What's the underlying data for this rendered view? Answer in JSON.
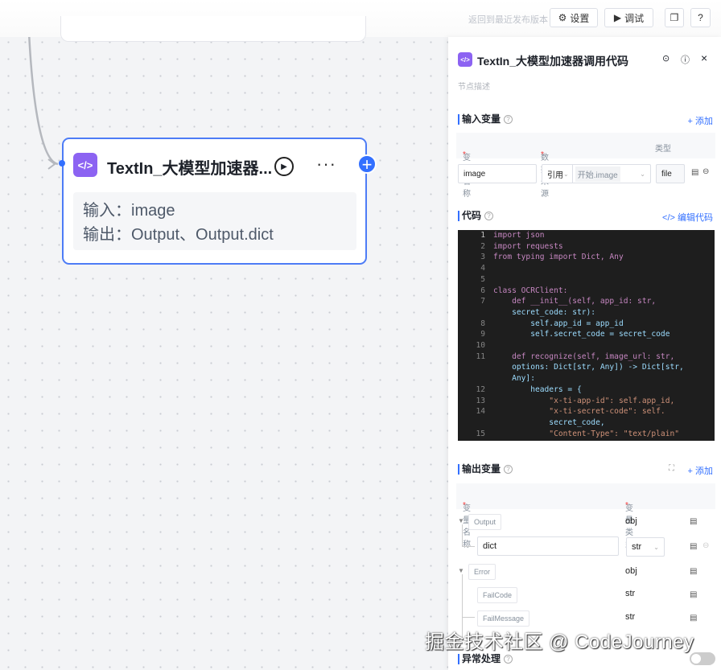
{
  "topbar": {
    "revert": "返回到最近发布版本",
    "settings": "设置",
    "debug": "调试"
  },
  "node": {
    "title": "TextIn_大模型加速器...",
    "input": "输入：image",
    "output": "输出：Output、Output.dict"
  },
  "panel": {
    "title": "TextIn_大模型加速器调用代码",
    "description_placeholder": "节点描述",
    "input_section": {
      "title": "输入变量",
      "add": "+ 添加",
      "headers": [
        "变量名称",
        "数据来源",
        "类型"
      ],
      "row": {
        "name": "image",
        "source_mode": "引用",
        "source_value": "开始.image",
        "type": "file"
      }
    },
    "code_section": {
      "title": "代码",
      "edit": "</> 编辑代码"
    },
    "output_section": {
      "title": "输出变量",
      "add": "+ 添加",
      "headers": [
        "变量名称",
        "变量类型"
      ],
      "rows": [
        {
          "name": "Output",
          "type": "obj"
        },
        {
          "name": "dict",
          "type": "str"
        },
        {
          "name": "Error",
          "type": "obj"
        },
        {
          "name": "FailCode",
          "type": "str"
        },
        {
          "name": "FailMessage",
          "type": "str"
        }
      ]
    },
    "exception_section": {
      "title": "异常处理",
      "enabled": false
    }
  },
  "code_lines": [
    [
      "1",
      "import json"
    ],
    [
      "2",
      "import requests"
    ],
    [
      "3",
      "from typing import Dict, Any"
    ],
    [
      "4",
      ""
    ],
    [
      "5",
      ""
    ],
    [
      "6",
      "class OCRClient:"
    ],
    [
      "7",
      "    def __init__(self, app_id: str,"
    ],
    [
      "",
      "    secret_code: str):"
    ],
    [
      "8",
      "        self.app_id = app_id"
    ],
    [
      "9",
      "        self.secret_code = secret_code"
    ],
    [
      "10",
      ""
    ],
    [
      "11",
      "    def recognize(self, image_url: str,"
    ],
    [
      "",
      "    options: Dict[str, Any]) -> Dict[str,"
    ],
    [
      "",
      "    Any]:"
    ],
    [
      "12",
      "        headers = {"
    ],
    [
      "13",
      "            \"x-ti-app-id\": self.app_id,"
    ],
    [
      "14",
      "            \"x-ti-secret-code\": self."
    ],
    [
      "",
      "            secret_code,"
    ],
    [
      "15",
      "            \"Content-Type\": \"text/plain\""
    ]
  ],
  "watermark": "掘金技术社区 @ CodeJourney"
}
